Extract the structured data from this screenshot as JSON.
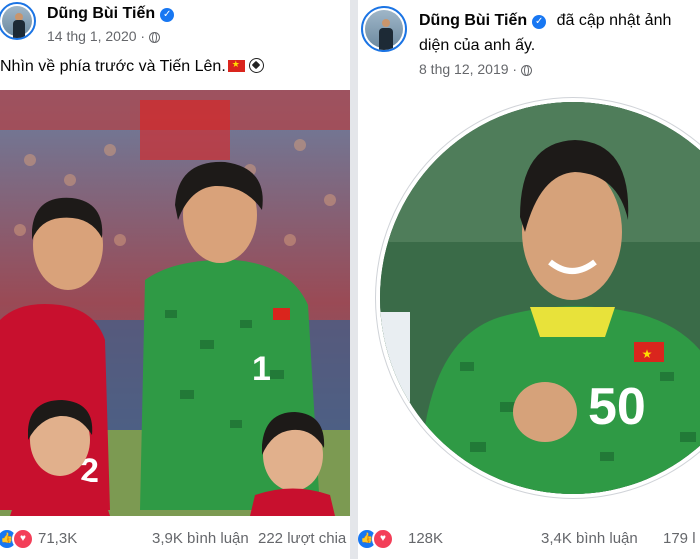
{
  "left_post": {
    "author": "Dũng Bùi Tiến",
    "date": "14 thg 1, 2020",
    "separator": "·",
    "text": "Nhìn về phía trước và Tiến Lên.",
    "reaction_count": "71,3K",
    "comments": "3,9K bình luận",
    "shares": "222 lượt chia",
    "jersey_numbers": [
      "2",
      "1"
    ]
  },
  "right_post": {
    "author": "Dũng Bùi Tiến",
    "action_line1": "đã cập nhật ảnh",
    "action_line2": "diện của anh ấy.",
    "date": "8 thg 12, 2019",
    "separator": "·",
    "reaction_count": "128K",
    "comments": "3,4K bình luận",
    "shares": "179 l",
    "jersey_number": "50"
  },
  "icons": [
    "verified-badge-icon",
    "globe-icon",
    "like-reaction-icon",
    "love-reaction-icon",
    "vietnam-flag-emoji",
    "soccer-ball-emoji"
  ],
  "colors": {
    "facebook_blue": "#1877f2",
    "love_red": "#f33e58",
    "meta_gray": "#65676b",
    "jersey_green": "#2f9a45",
    "jersey_red": "#c8102e"
  }
}
